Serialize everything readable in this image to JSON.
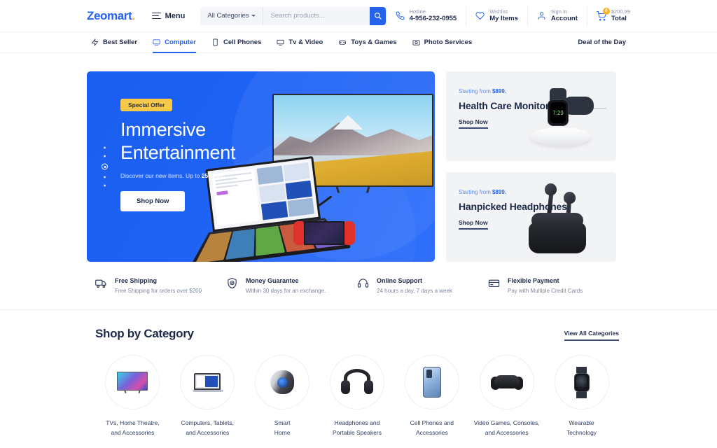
{
  "header": {
    "logo": "Zeomart",
    "logo_dot": ".",
    "menu_label": "Menu",
    "search": {
      "category_label": "All Categories",
      "placeholder": "Search products...",
      "value": ""
    },
    "utilities": [
      {
        "top": "Hotline",
        "bottom": "4-956-232-0955",
        "icon": "phone-icon"
      },
      {
        "top": "Wishlist",
        "bottom": "My Items",
        "icon": "heart-icon"
      },
      {
        "top": "Sign In",
        "bottom": "Account",
        "icon": "user-icon"
      },
      {
        "top": "$200.99",
        "bottom": "Total",
        "icon": "cart-icon",
        "badge": "0"
      }
    ]
  },
  "nav": {
    "items": [
      {
        "label": "Best Seller",
        "icon": "bolt-icon",
        "active": false
      },
      {
        "label": "Computer",
        "icon": "monitor-icon",
        "active": true
      },
      {
        "label": "Cell Phones",
        "icon": "phone-device-icon",
        "active": false
      },
      {
        "label": "Tv & Video",
        "icon": "tv-icon",
        "active": false
      },
      {
        "label": "Toys & Games",
        "icon": "gamepad-icon",
        "active": false
      },
      {
        "label": "Photo Services",
        "icon": "camera-icon",
        "active": false
      }
    ],
    "deal_label": "Deal of the Day"
  },
  "hero": {
    "badge": "Special Offer",
    "title_line1": "Immersive",
    "title_line2": "Entertainment",
    "subtitle_pre": "Discover our new items. Up to ",
    "subtitle_bold": "25% Off",
    "subtitle_post": " !",
    "cta": "Shop Now",
    "slides": 5,
    "active_slide": 3
  },
  "promos": [
    {
      "kicker_pre": "Starting from ",
      "kicker_price": "$899.",
      "title": "Health Care Monitor",
      "link": "Shop Now",
      "art": "smart-watch",
      "watch_time": "7:29"
    },
    {
      "kicker_pre": "Starting from ",
      "kicker_price": "$899.",
      "title": "Hanpicked Headphones",
      "link": "Shop Now",
      "art": "earbuds"
    }
  ],
  "features": [
    {
      "title": "Free Shipping",
      "desc": "Free Shipping for orders over $200",
      "icon": "truck-icon"
    },
    {
      "title": "Money Guarantee",
      "desc": "Within 30 days for an exchange.",
      "icon": "shield-check-icon"
    },
    {
      "title": "Online Support",
      "desc": "24 hours a day, 7 days a week",
      "icon": "headset-icon"
    },
    {
      "title": "Flexible Payment",
      "desc": "Pay with Multiple Credit Cards",
      "icon": "credit-card-icon"
    }
  ],
  "category_section": {
    "title": "Shop by Category",
    "view_all": "View All Categories",
    "items": [
      {
        "label": "TVs, Home Theatre,\nand Accessories",
        "art": "tv"
      },
      {
        "label": "Computers, Tablets,\nand Accessories",
        "art": "laptop"
      },
      {
        "label": "Smart\nHome",
        "art": "smart-speaker"
      },
      {
        "label": "Headphones and\nPortable Speakers",
        "art": "headphones"
      },
      {
        "label": "Cell Phones and\nAccessories",
        "art": "phone"
      },
      {
        "label": "Video Games, Consoles,\nand Accessories",
        "art": "gamepad"
      },
      {
        "label": "Wearable\nTechnology",
        "art": "watch"
      }
    ]
  },
  "colors": {
    "accent": "#2563eb",
    "hero_bg": "#1f63f5",
    "badge_yellow": "#f7c948",
    "dark_navy": "#1e2a4a",
    "promo_bg": "#f2f3f5"
  }
}
